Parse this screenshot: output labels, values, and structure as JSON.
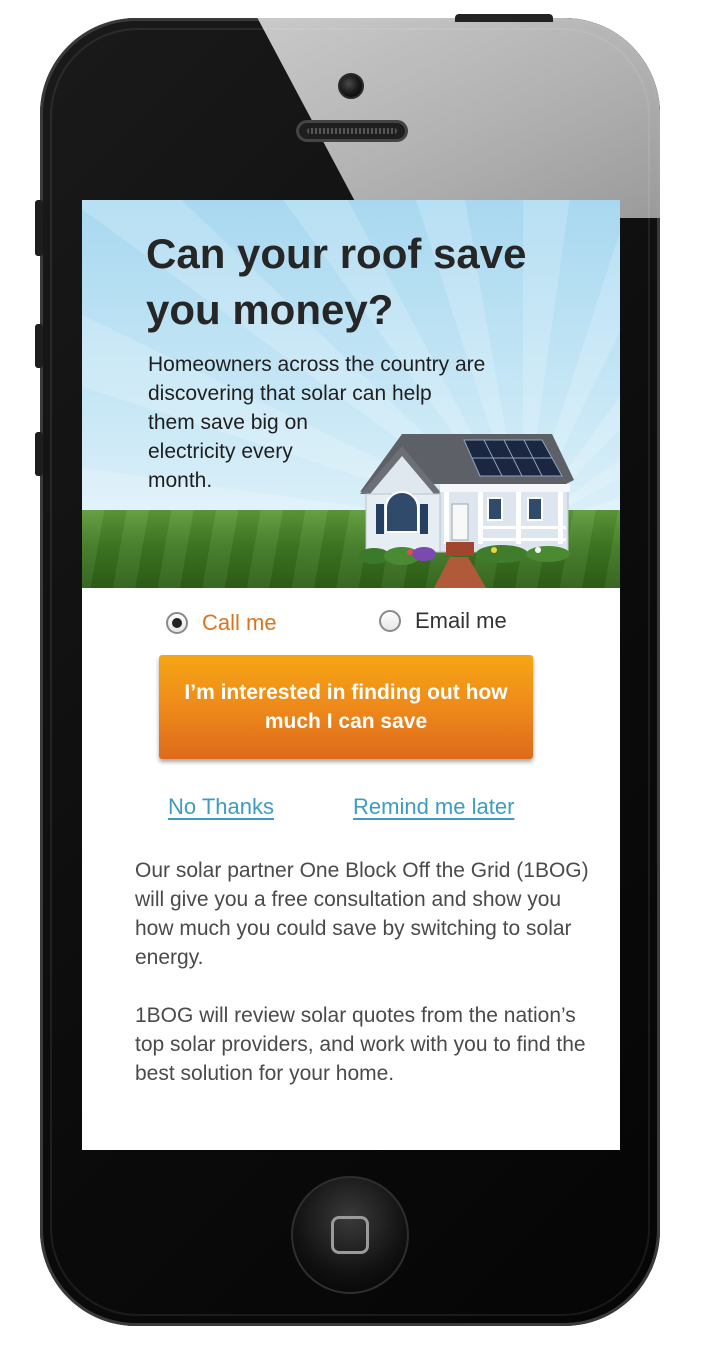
{
  "hero": {
    "title": "Can your roof save you money?",
    "subtitle_line1": "Homeowners across the country are discovering that solar can help",
    "subtitle_line2": "them save big on electricity every month."
  },
  "contact_options": {
    "call_label": "Call me",
    "email_label": "Email me",
    "selected": "call"
  },
  "cta": {
    "label": "I’m interested in finding out how much I can save"
  },
  "links": {
    "no_thanks": "No Thanks",
    "remind_later": "Remind me later"
  },
  "info": {
    "paragraph1": "Our solar partner One Block Off the Grid (1BOG) will give you a free consultation and show you how much you could save by switching to solar energy.",
    "paragraph2": "1BOG will review solar quotes from the nation’s top solar providers, and work with you to find the best solution for your home."
  },
  "colors": {
    "accent_orange": "#ee8a1a",
    "link_blue": "#3d9cc0",
    "selected_label": "#d9741e"
  },
  "icons": {
    "radio_selected": "radio-selected-icon",
    "radio_unselected": "radio-unselected-icon",
    "home": "home-square-icon"
  }
}
